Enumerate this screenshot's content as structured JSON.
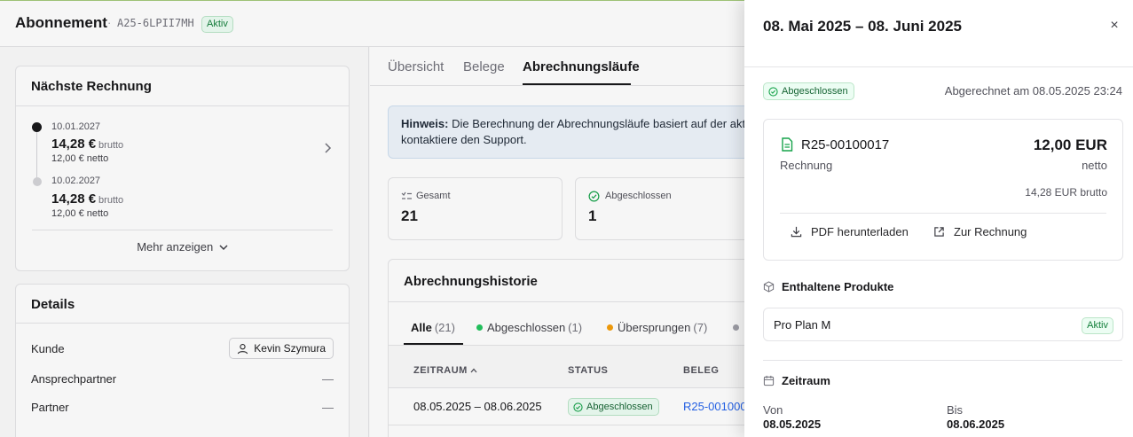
{
  "header": {
    "title": "Abonnement",
    "separator": "·",
    "subscription_code": "A25-6LPII7MH",
    "status": "Aktiv"
  },
  "next_invoice": {
    "title": "Nächste Rechnung",
    "items": [
      {
        "date": "10.01.2027",
        "amount": "14,28 €",
        "gross_label": "brutto",
        "net": "12,00 € netto"
      },
      {
        "date": "10.02.2027",
        "amount": "14,28 €",
        "gross_label": "brutto",
        "net": "12,00 € netto"
      }
    ],
    "more_label": "Mehr anzeigen"
  },
  "details": {
    "title": "Details",
    "rows": [
      {
        "label": "Kunde",
        "value": "Kevin Szymura"
      },
      {
        "label": "Ansprechpartner",
        "value": "—"
      },
      {
        "label": "Partner",
        "value": "—"
      }
    ]
  },
  "main_tabs": [
    {
      "label": "Übersicht"
    },
    {
      "label": "Belege"
    },
    {
      "label": "Abrechnungsläufe"
    }
  ],
  "hint": {
    "bold": "Hinweis:",
    "line1": "Die Berechnung der Abrechnungsläufe basiert auf der akt",
    "line2": "kontaktiere den Support."
  },
  "stats": [
    {
      "label": "Gesamt",
      "value": "21"
    },
    {
      "label": "Abgeschlossen",
      "value": "1"
    }
  ],
  "history": {
    "title": "Abrechnungshistorie",
    "filters": [
      {
        "label": "Alle",
        "count": "(21)",
        "color": ""
      },
      {
        "label": "Abgeschlossen",
        "count": "(1)",
        "color": "#22c55e"
      },
      {
        "label": "Übersprungen",
        "count": "(7)",
        "color": "#f59e0b"
      },
      {
        "label": "",
        "count": "",
        "color": "#a1a1aa"
      }
    ],
    "columns": [
      "ZEITRAUM",
      "STATUS",
      "BELEG"
    ],
    "rows": [
      {
        "period": "08.05.2025 – 08.06.2025",
        "status": "Abgeschlossen",
        "doc": "R25-00100017"
      }
    ]
  },
  "drawer": {
    "title": "08. Mai 2025 – 08. Juni 2025",
    "close_glyph": "×",
    "status": "Abgeschlossen",
    "billed_at": "Abgerechnet am 08.05.2025 23:24",
    "invoice": {
      "number": "R25-00100017",
      "type": "Rechnung",
      "amount": "12,00 EUR",
      "net_label": "netto",
      "gross": "14,28 EUR brutto",
      "download_label": "PDF herunterladen",
      "open_label": "Zur Rechnung"
    },
    "products": {
      "title": "Enthaltene Produkte",
      "items": [
        {
          "name": "Pro Plan M",
          "status": "Aktiv"
        }
      ]
    },
    "period": {
      "title": "Zeitraum",
      "from_label": "Von",
      "from": "08.05.2025",
      "to_label": "Bis",
      "to": "08.06.2025"
    }
  },
  "colors": {
    "success": "#15803d",
    "success_bg": "#ecfdf3",
    "link": "#2563eb",
    "hint_bg": "#eef4fb"
  },
  "icons": [
    "chevron-right-icon",
    "chevron-down-icon",
    "user-icon",
    "list-icon",
    "check-circle-icon",
    "sort-asc-icon",
    "document-icon",
    "download-icon",
    "external-link-icon",
    "package-icon",
    "calendar-icon",
    "close-icon"
  ]
}
